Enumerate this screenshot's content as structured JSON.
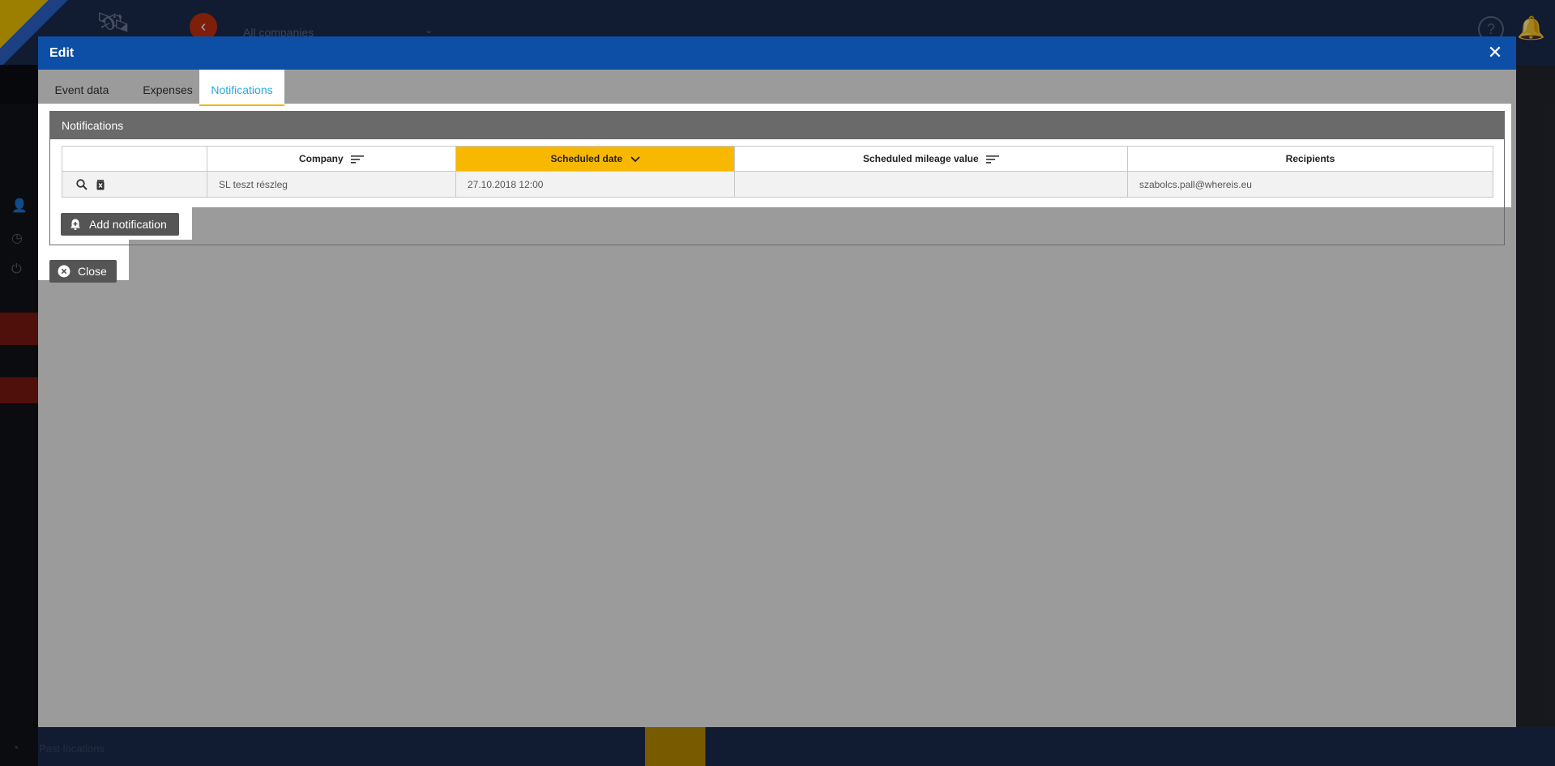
{
  "background": {
    "company_selector": "All companies",
    "past_locations": "Past locations"
  },
  "modal": {
    "title": "Edit",
    "tabs": [
      {
        "label": "Event data",
        "active": false
      },
      {
        "label": "Expenses",
        "active": false
      },
      {
        "label": "Notifications",
        "active": true
      }
    ],
    "section_title": "Notifications",
    "table": {
      "columns": [
        "",
        "Company",
        "Scheduled date",
        "Scheduled mileage value",
        "Recipients"
      ],
      "sorted_column": "Scheduled date",
      "rows": [
        {
          "company": "SL teszt részleg",
          "scheduled_date": "27.10.2018 12:00",
          "mileage": "",
          "recipients": "szabolcs.pall@whereis.eu"
        }
      ]
    },
    "add_button_label": "Add notification",
    "close_button_label": "Close"
  },
  "colors": {
    "header_blue": "#0d4fa6",
    "accent_yellow": "#f8b800",
    "tab_active_text": "#29a8e0",
    "button_gray": "#555555",
    "section_header_gray": "#6a6a6a"
  }
}
